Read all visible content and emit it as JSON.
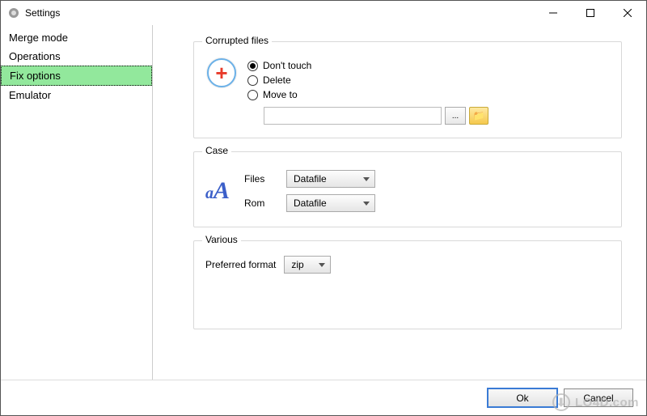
{
  "window": {
    "title": "Settings"
  },
  "sidebar": {
    "items": [
      {
        "label": "Merge mode"
      },
      {
        "label": "Operations"
      },
      {
        "label": "Fix options"
      },
      {
        "label": "Emulator"
      }
    ]
  },
  "corrupted": {
    "legend": "Corrupted files",
    "options": {
      "dont_touch": "Don't touch",
      "delete": "Delete",
      "move_to": "Move to"
    },
    "path_value": "",
    "browse_label": "..."
  },
  "case": {
    "legend": "Case",
    "files_label": "Files",
    "rom_label": "Rom",
    "files_value": "Datafile",
    "rom_value": "Datafile"
  },
  "various": {
    "legend": "Various",
    "preferred_format_label": "Preferred format",
    "preferred_format_value": "zip"
  },
  "buttons": {
    "ok": "Ok",
    "cancel": "Cancel"
  },
  "watermark": "LO4D.com"
}
